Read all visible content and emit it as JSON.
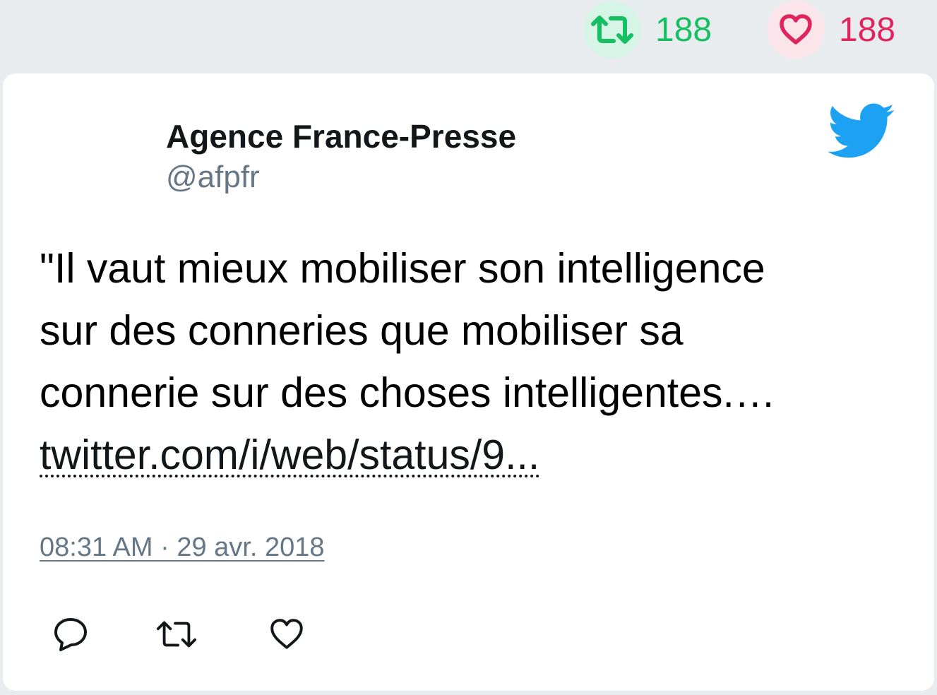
{
  "stats": {
    "retweet_count": "188",
    "like_count": "188",
    "retweet_color": "#17bf63",
    "like_color": "#e0245e",
    "retweet_icon": "retweet-icon",
    "like_icon": "heart-icon"
  },
  "tweet": {
    "author_name": "Agence France-Presse",
    "author_handle": "@afpfr",
    "text_lines": [
      "\"Il vaut mieux mobiliser son intelligence",
      "sur des conneries que mobiliser sa",
      "connerie sur des choses intelligentes.…"
    ],
    "link_text": "twitter.com/i/web/status/9...",
    "timestamp": "08:31 AM · 29 avr. 2018",
    "brand_icon": "twitter-bird-icon",
    "brand_color": "#1da1f2"
  },
  "actions": {
    "reply_icon": "reply-icon",
    "retweet_icon": "retweet-icon",
    "like_icon": "heart-icon"
  }
}
